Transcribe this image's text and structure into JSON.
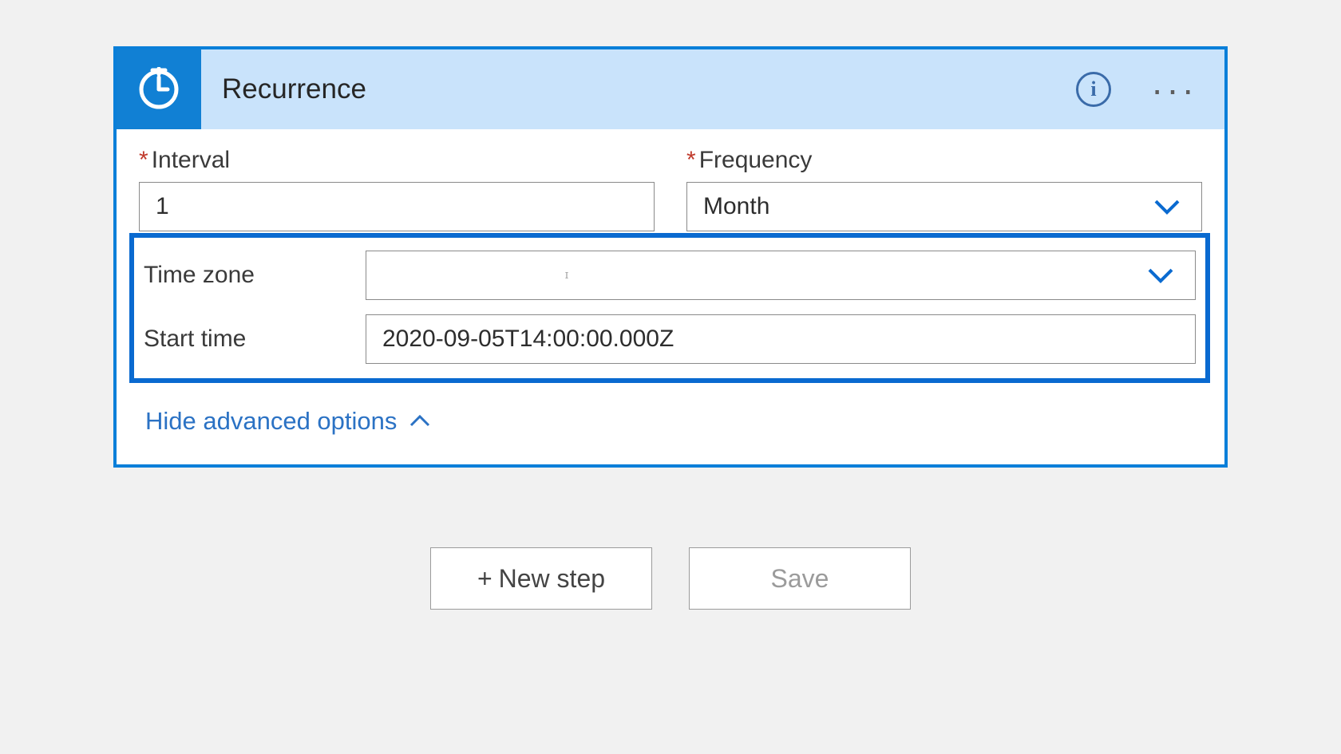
{
  "card": {
    "title": "Recurrence"
  },
  "labels": {
    "interval": "Interval",
    "frequency": "Frequency",
    "time_zone": "Time zone",
    "start_time": "Start time"
  },
  "values": {
    "interval": "1",
    "frequency": "Month",
    "time_zone": "",
    "start_time": "2020-09-05T14:00:00.000Z"
  },
  "actions": {
    "hide_advanced": "Hide advanced options",
    "new_step": "New step",
    "save": "Save",
    "plus": "+"
  },
  "required_marker": "*"
}
